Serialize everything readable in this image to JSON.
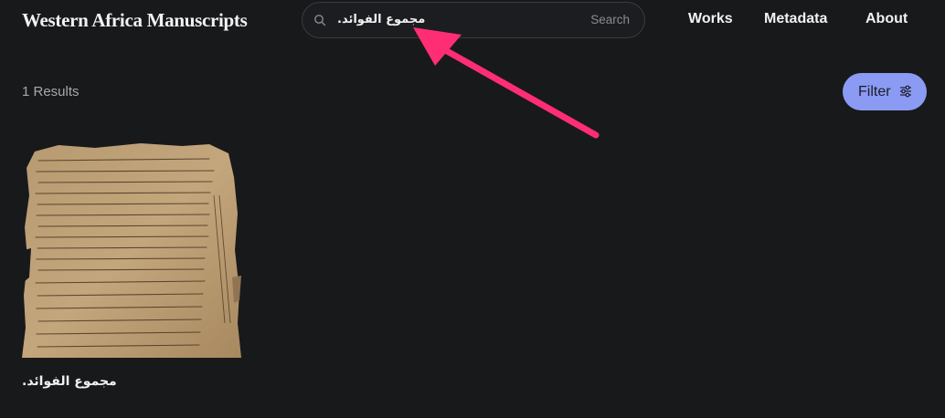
{
  "header": {
    "site_title": "Western Africa Manuscripts",
    "search": {
      "value": "مجموع الفوائد.",
      "button_label": "Search",
      "icon": "search-icon"
    },
    "nav": [
      {
        "label": "Works"
      },
      {
        "label": "Metadata"
      },
      {
        "label": "About"
      }
    ]
  },
  "results": {
    "count_label": "1 Results",
    "filter_label": "Filter",
    "filter_icon": "sliders-icon",
    "items": [
      {
        "title": "مجموع الفوائد."
      }
    ]
  },
  "colors": {
    "background": "#18191b",
    "accent": "#8b9bf4",
    "annotation_arrow": "#ff2e74"
  }
}
